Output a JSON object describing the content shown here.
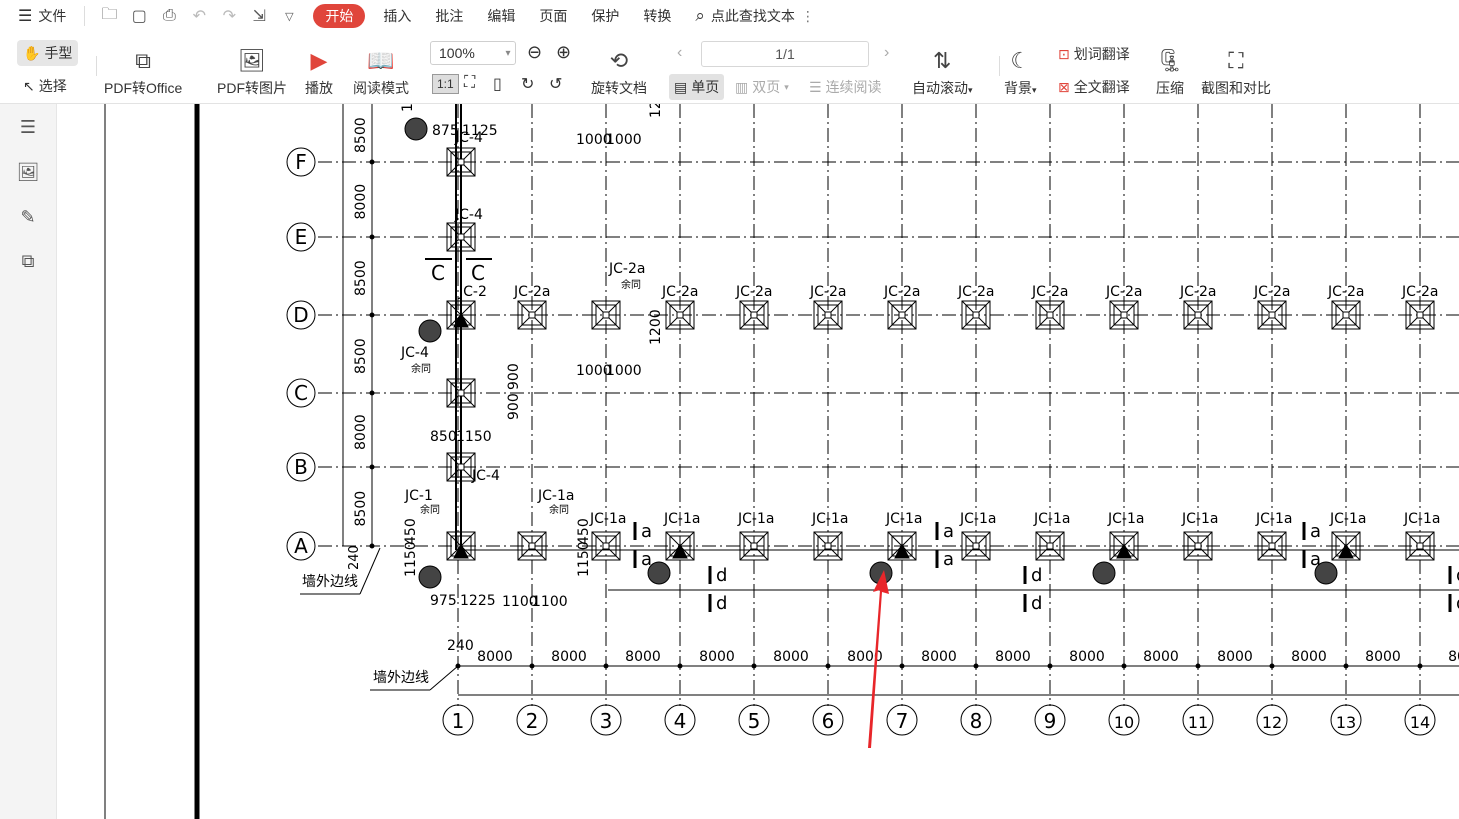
{
  "menu": {
    "file_label": "文件",
    "tabs": [
      "开始",
      "插入",
      "批注",
      "编辑",
      "页面",
      "保护",
      "转换"
    ],
    "search_label": "点此查找文本"
  },
  "toolbar": {
    "hand_label": "手型",
    "select_label": "选择",
    "pdf_to_office": "PDF转Office",
    "pdf_to_image": "PDF转图片",
    "play": "播放",
    "read_mode": "阅读模式",
    "zoom": "100%",
    "rotate_doc": "旋转文档",
    "page_value": "1/1",
    "single_page": "单页",
    "double_page": "双页",
    "continuous": "连续阅读",
    "auto_scroll": "自动滚动",
    "background": "背景",
    "word_translate": "划词翻译",
    "full_translate": "全文翻译",
    "compress": "压缩",
    "screenshot_compare": "截图和对比"
  },
  "drawing": {
    "row_labels": [
      "F",
      "E",
      "D",
      "C",
      "B",
      "A"
    ],
    "col_labels": [
      "1",
      "2",
      "3",
      "4",
      "5",
      "6",
      "7",
      "8",
      "9",
      "10",
      "11",
      "12",
      "13",
      "14"
    ],
    "left_dims": [
      "8500",
      "8000",
      "8500",
      "8500",
      "8000",
      "8500"
    ],
    "bottom_dims": [
      "8000",
      "8000",
      "8000",
      "8000",
      "8000",
      "8000",
      "8000",
      "8000",
      "8000",
      "8000",
      "8000",
      "8000",
      "8000",
      "80"
    ],
    "jc4": "JC-4",
    "jc2": "JC-2",
    "jc2a": "JC-2a",
    "jc1": "JC-1",
    "jc1a": "JC-1a",
    "same": "余同",
    "section_c": "C",
    "wall_line": "墙外边线",
    "dim_240": "240",
    "dim_875": "875",
    "dim_1125": "1125",
    "dim_1000": "1000",
    "dim_1200": "1200",
    "dim_12": "12",
    "dim_900": "900",
    "dim_850": "850",
    "dim_1150": "1150",
    "dim_450": "450",
    "dim_975": "975",
    "dim_1225": "1225",
    "dim_1100": "1100",
    "mark_a": "a",
    "mark_d": "d"
  },
  "colors": {
    "accent": "#e0453b",
    "arrow": "#e8262a"
  }
}
